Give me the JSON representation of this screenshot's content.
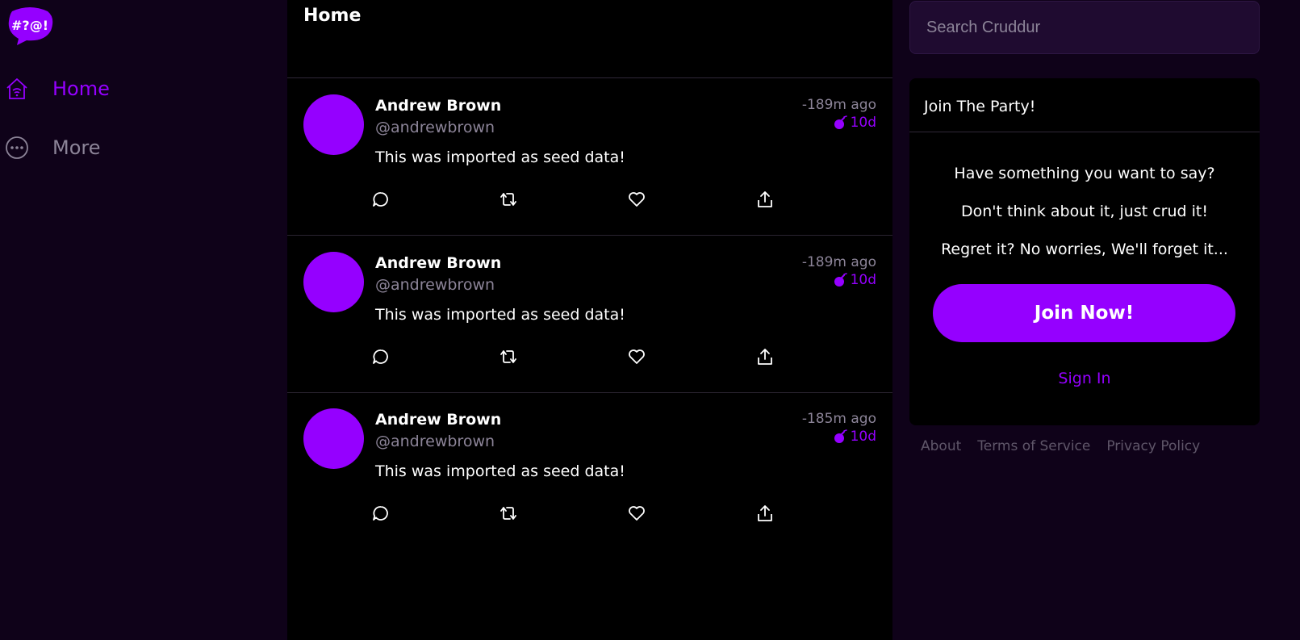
{
  "app": {
    "logo_text": "#?@!"
  },
  "sidebar": {
    "items": [
      {
        "label": "Home",
        "icon": "home-icon",
        "active": true
      },
      {
        "label": "More",
        "icon": "more-icon",
        "active": false
      }
    ]
  },
  "feed": {
    "title": "Home",
    "activities": [
      {
        "display_name": "Andrew Brown",
        "handle": "@andrewbrown",
        "message": "This was imported as seed data!",
        "ago": "-189m ago",
        "expires": "10d"
      },
      {
        "display_name": "Andrew Brown",
        "handle": "@andrewbrown",
        "message": "This was imported as seed data!",
        "ago": "-189m ago",
        "expires": "10d"
      },
      {
        "display_name": "Andrew Brown",
        "handle": "@andrewbrown",
        "message": "This was imported as seed data!",
        "ago": "-185m ago",
        "expires": "10d"
      }
    ]
  },
  "search": {
    "placeholder": "Search Cruddur"
  },
  "join": {
    "title": "Join The Party!",
    "lines": [
      "Have something you want to say?",
      "Don't think about it, just crud it!",
      "Regret it? No worries, We'll forget it..."
    ],
    "button_label": "Join Now!",
    "signin_label": "Sign In"
  },
  "footer": {
    "links": [
      "About",
      "Terms of Service",
      "Privacy Policy"
    ]
  },
  "colors": {
    "accent": "#9500ff",
    "page_background": "#0f0219",
    "feed_background": "#000000",
    "muted_text": "#8c8498"
  }
}
